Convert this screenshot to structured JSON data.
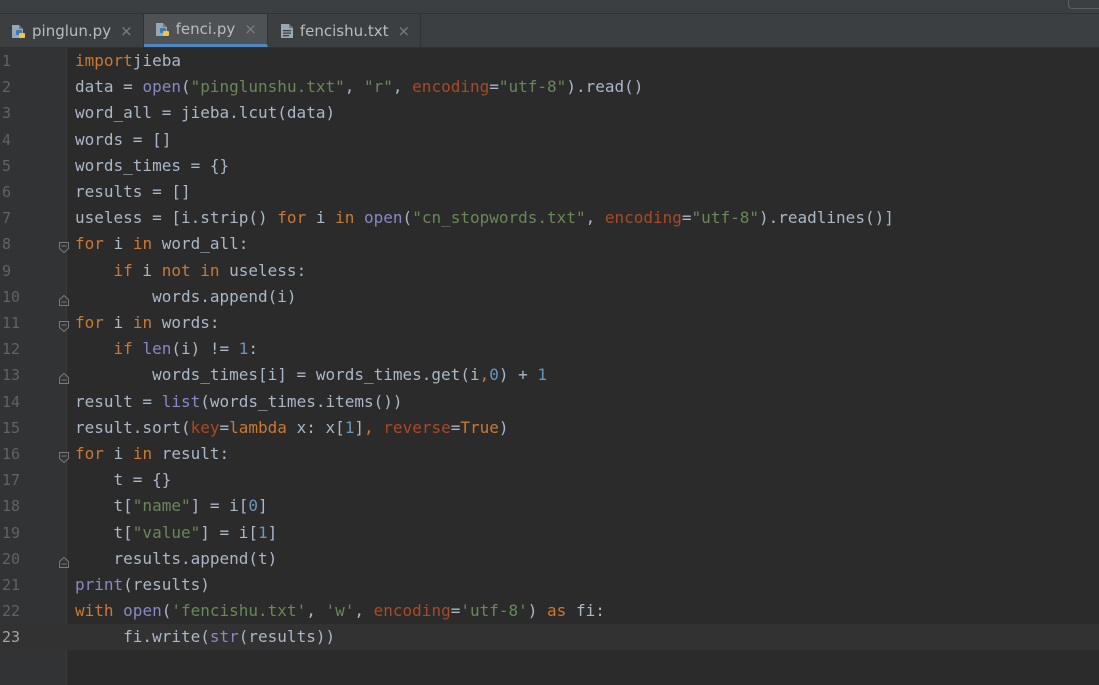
{
  "tabs": [
    {
      "label": "pinglun.py",
      "icon": "python-file-icon",
      "active": false
    },
    {
      "label": "fenci.py",
      "icon": "python-file-icon",
      "active": true
    },
    {
      "label": "fencishu.txt",
      "icon": "text-file-icon",
      "active": false
    }
  ],
  "close_glyph": "×",
  "editor": {
    "current_line": 23,
    "lines": [
      {
        "n": "1",
        "tokens": [
          [
            "kw",
            "import"
          ],
          [
            "",
            "jieba"
          ]
        ]
      },
      {
        "n": "2",
        "tokens": [
          [
            "",
            "data = "
          ],
          [
            "bi",
            "open"
          ],
          [
            "",
            "("
          ],
          [
            "str",
            "\"pinglunshu.txt\""
          ],
          [
            "",
            ", "
          ],
          [
            "str",
            "\"r\""
          ],
          [
            "",
            ", "
          ],
          [
            "prm",
            "encoding"
          ],
          [
            "",
            "="
          ],
          [
            "str",
            "\"utf-8\""
          ],
          [
            "",
            ").read()"
          ]
        ]
      },
      {
        "n": "3",
        "tokens": [
          [
            "",
            "word_all = jieba.lcut(data)"
          ]
        ]
      },
      {
        "n": "4",
        "tokens": [
          [
            "",
            "words = []"
          ]
        ]
      },
      {
        "n": "5",
        "tokens": [
          [
            "",
            "words_times = {}"
          ]
        ]
      },
      {
        "n": "6",
        "tokens": [
          [
            "",
            "results = []"
          ]
        ]
      },
      {
        "n": "7",
        "tokens": [
          [
            "",
            "useless = [i.strip() "
          ],
          [
            "kw",
            "for"
          ],
          [
            "",
            " i "
          ],
          [
            "kw",
            "in"
          ],
          [
            "",
            " "
          ],
          [
            "bi",
            "open"
          ],
          [
            "",
            "("
          ],
          [
            "str",
            "\"cn_stopwords.txt\""
          ],
          [
            "",
            ", "
          ],
          [
            "prm",
            "encoding"
          ],
          [
            "",
            "="
          ],
          [
            "str",
            "\"utf-8\""
          ],
          [
            "",
            ").readlines()]"
          ]
        ]
      },
      {
        "n": "8",
        "tokens": [
          [
            "kw",
            "for"
          ],
          [
            "",
            " i "
          ],
          [
            "kw",
            "in"
          ],
          [
            "",
            " word_all:"
          ]
        ]
      },
      {
        "n": "9",
        "tokens": [
          [
            "",
            "    "
          ],
          [
            "kw",
            "if"
          ],
          [
            "",
            " i "
          ],
          [
            "kw",
            "not in"
          ],
          [
            "",
            " useless:"
          ]
        ]
      },
      {
        "n": "10",
        "tokens": [
          [
            "",
            "        words.append(i)"
          ]
        ]
      },
      {
        "n": "11",
        "tokens": [
          [
            "kw",
            "for"
          ],
          [
            "",
            " i "
          ],
          [
            "kw",
            "in"
          ],
          [
            "",
            " words:"
          ]
        ]
      },
      {
        "n": "12",
        "tokens": [
          [
            "",
            "    "
          ],
          [
            "kw",
            "if"
          ],
          [
            "",
            " "
          ],
          [
            "bi",
            "len"
          ],
          [
            "",
            "(i) != "
          ],
          [
            "num",
            "1"
          ],
          [
            "",
            ":"
          ]
        ]
      },
      {
        "n": "13",
        "tokens": [
          [
            "",
            "        words_times[i] = words_times.get(i"
          ],
          [
            "kw",
            ","
          ],
          [
            "num",
            "0"
          ],
          [
            "",
            ") + "
          ],
          [
            "num",
            "1"
          ]
        ]
      },
      {
        "n": "14",
        "tokens": [
          [
            "",
            "result = "
          ],
          [
            "bi",
            "list"
          ],
          [
            "",
            "(words_times.items())"
          ]
        ]
      },
      {
        "n": "15",
        "tokens": [
          [
            "",
            "result.sort("
          ],
          [
            "prm",
            "key"
          ],
          [
            "",
            "="
          ],
          [
            "kw",
            "lambda"
          ],
          [
            "",
            " x: x["
          ],
          [
            "num",
            "1"
          ],
          [
            "",
            "]"
          ],
          [
            "kw",
            ","
          ],
          [
            "",
            " "
          ],
          [
            "prm",
            "reverse"
          ],
          [
            "",
            "="
          ],
          [
            "kw",
            "True"
          ],
          [
            "",
            ")"
          ]
        ]
      },
      {
        "n": "16",
        "tokens": [
          [
            "kw",
            "for"
          ],
          [
            "",
            " i "
          ],
          [
            "kw",
            "in"
          ],
          [
            "",
            " result:"
          ]
        ]
      },
      {
        "n": "17",
        "tokens": [
          [
            "",
            "    t = {}"
          ]
        ]
      },
      {
        "n": "18",
        "tokens": [
          [
            "",
            "    t["
          ],
          [
            "str",
            "\"name\""
          ],
          [
            "",
            "] = i["
          ],
          [
            "num",
            "0"
          ],
          [
            "",
            "]"
          ]
        ]
      },
      {
        "n": "19",
        "tokens": [
          [
            "",
            "    t["
          ],
          [
            "str",
            "\"value\""
          ],
          [
            "",
            "] = i["
          ],
          [
            "num",
            "1"
          ],
          [
            "",
            "]"
          ]
        ]
      },
      {
        "n": "20",
        "tokens": [
          [
            "",
            "    results.append(t)"
          ]
        ]
      },
      {
        "n": "21",
        "tokens": [
          [
            "bi",
            "print"
          ],
          [
            "",
            "(results)"
          ]
        ]
      },
      {
        "n": "22",
        "tokens": [
          [
            "kw",
            "with"
          ],
          [
            "",
            " "
          ],
          [
            "bi",
            "open"
          ],
          [
            "",
            "("
          ],
          [
            "str",
            "'fencishu.txt'"
          ],
          [
            "",
            ", "
          ],
          [
            "str",
            "'w'"
          ],
          [
            "",
            ", "
          ],
          [
            "prm",
            "encoding"
          ],
          [
            "",
            "="
          ],
          [
            "str",
            "'utf-8'"
          ],
          [
            "",
            ") "
          ],
          [
            "kw",
            "as"
          ],
          [
            "",
            " fi:"
          ]
        ]
      },
      {
        "n": "23",
        "tokens": [
          [
            "",
            "     fi.write("
          ],
          [
            "bi",
            "str"
          ],
          [
            "",
            "(results))"
          ]
        ]
      }
    ]
  },
  "colors": {
    "keyword": "#cc7832",
    "string": "#6a8759",
    "number": "#6897bb",
    "builtin": "#8888c6",
    "param": "#aa4926",
    "text": "#a9b7c6"
  }
}
